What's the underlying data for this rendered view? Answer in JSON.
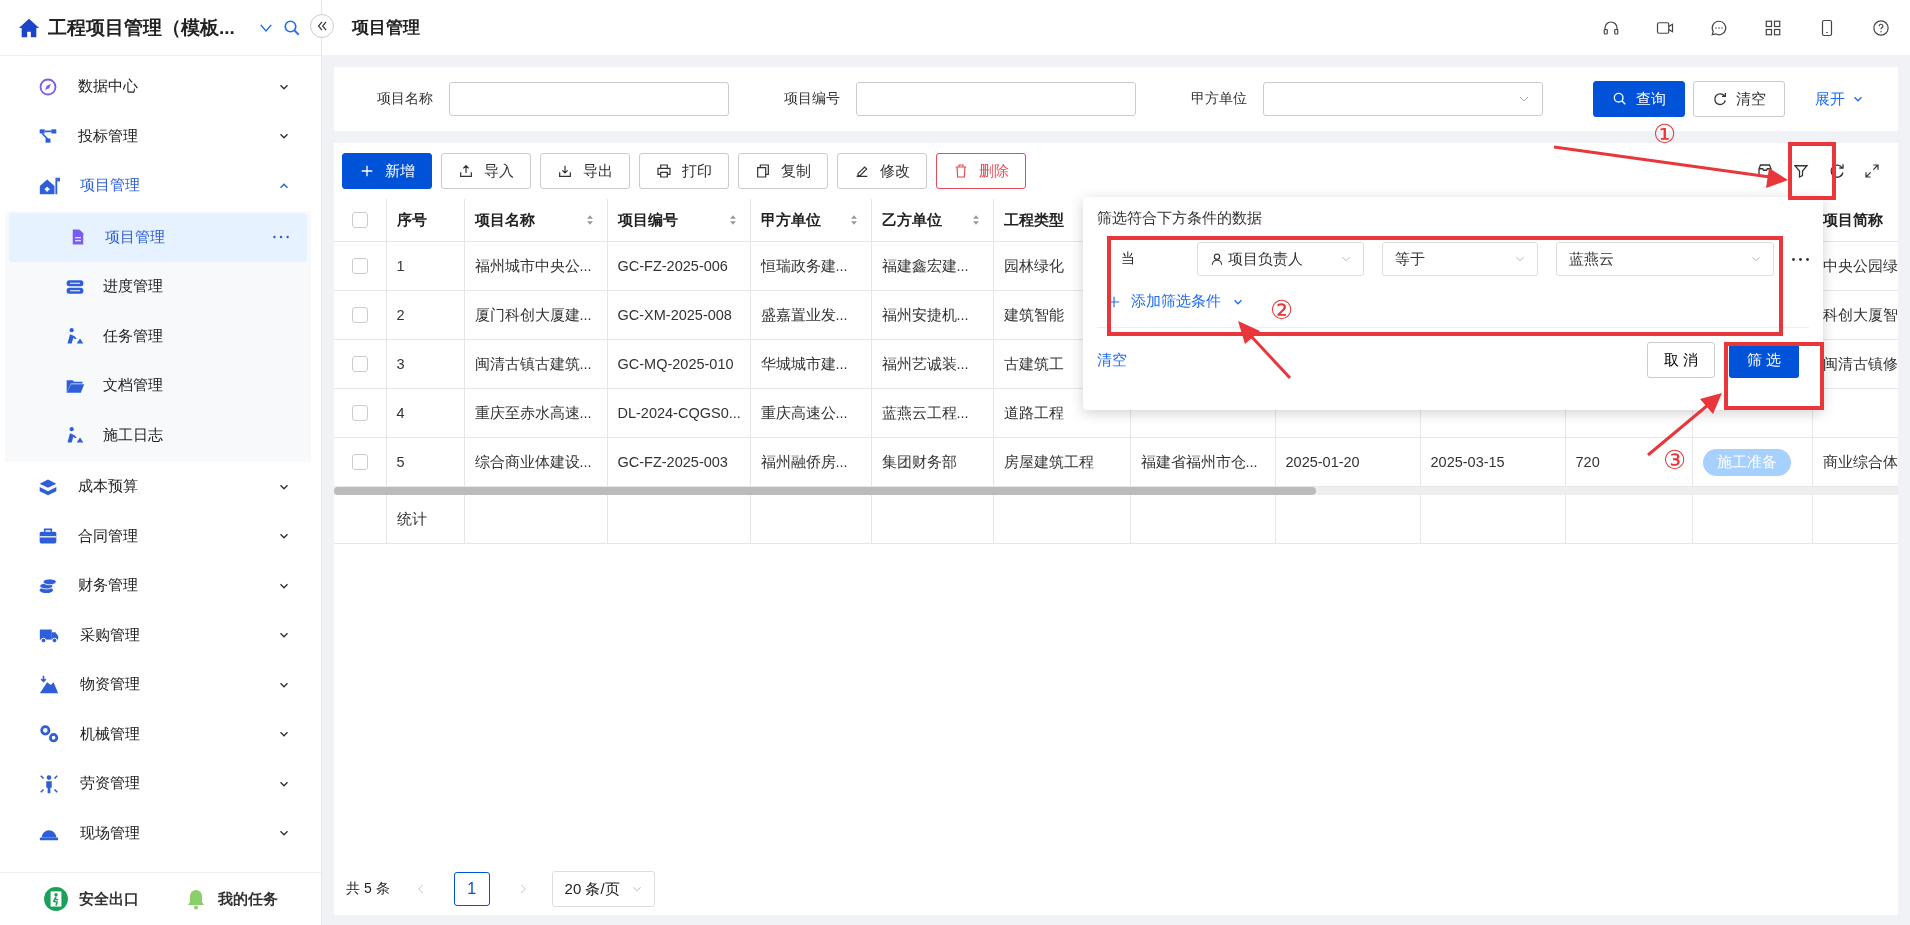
{
  "app": {
    "title": "工程项目管理（模板...",
    "page_title": "项目管理"
  },
  "sidebar": {
    "items": [
      {
        "label": "数据中心",
        "expanded": false
      },
      {
        "label": "投标管理",
        "expanded": false
      },
      {
        "label": "项目管理",
        "expanded": true,
        "children": [
          {
            "label": "项目管理",
            "selected": true
          },
          {
            "label": "进度管理",
            "selected": false
          },
          {
            "label": "任务管理",
            "selected": false
          },
          {
            "label": "文档管理",
            "selected": false
          },
          {
            "label": "施工日志",
            "selected": false
          }
        ]
      },
      {
        "label": "成本预算",
        "expanded": false
      },
      {
        "label": "合同管理",
        "expanded": false
      },
      {
        "label": "财务管理",
        "expanded": false
      },
      {
        "label": "采购管理",
        "expanded": false
      },
      {
        "label": "物资管理",
        "expanded": false
      },
      {
        "label": "机械管理",
        "expanded": false
      },
      {
        "label": "劳资管理",
        "expanded": false
      },
      {
        "label": "现场管理",
        "expanded": false
      }
    ],
    "footer": [
      {
        "label": "安全出口"
      },
      {
        "label": "我的任务"
      }
    ]
  },
  "search_form": {
    "fields": [
      {
        "label": "项目名称",
        "kind": "text"
      },
      {
        "label": "项目编号",
        "kind": "text"
      },
      {
        "label": "甲方单位",
        "kind": "select"
      }
    ],
    "query": "查询",
    "reset": "清空",
    "expand": "展开"
  },
  "toolbar": [
    {
      "label": "新增",
      "kind": "primary"
    },
    {
      "label": "导入",
      "kind": "default"
    },
    {
      "label": "导出",
      "kind": "default"
    },
    {
      "label": "打印",
      "kind": "default"
    },
    {
      "label": "复制",
      "kind": "default"
    },
    {
      "label": "修改",
      "kind": "default"
    },
    {
      "label": "删除",
      "kind": "danger"
    }
  ],
  "table": {
    "header_checked": false,
    "columns": [
      {
        "label": "序号",
        "sortable": false,
        "kind": "text"
      },
      {
        "label": "项目名称",
        "sortable": true,
        "kind": "text"
      },
      {
        "label": "项目编号",
        "sortable": true,
        "kind": "text"
      },
      {
        "label": "甲方单位",
        "sortable": true,
        "kind": "text"
      },
      {
        "label": "乙方单位",
        "sortable": true,
        "kind": "text"
      },
      {
        "label": "工程类型",
        "kind": "text"
      },
      {
        "kind": "text"
      },
      {
        "kind": "text"
      },
      {
        "kind": "text"
      },
      {
        "kind": "text"
      },
      {
        "kind": "status"
      },
      {
        "label": "项目简称",
        "kind": "text"
      }
    ],
    "rows": [
      {
        "checked": false,
        "cells": [
          "1",
          "福州城市中央公...",
          "GC-FZ-2025-006",
          "恒瑞政务建...",
          "福建鑫宏建...",
          "园林绿化",
          null,
          null,
          null,
          null,
          null,
          "中央公园绿"
        ]
      },
      {
        "checked": false,
        "cells": [
          "2",
          "厦门科创大厦建...",
          "GC-XM-2025-008",
          "盛嘉置业发...",
          "福州安捷机...",
          "建筑智能",
          null,
          null,
          null,
          null,
          null,
          "科创大厦智"
        ]
      },
      {
        "checked": false,
        "cells": [
          "3",
          "闽清古镇古建筑...",
          "GC-MQ-2025-010",
          "华城城市建...",
          "福州艺诚装...",
          "古建筑工",
          null,
          null,
          null,
          null,
          null,
          "闽清古镇修"
        ]
      },
      {
        "checked": false,
        "cells": [
          "4",
          "重庆至赤水高速...",
          "DL-2024-CQGS0...",
          "重庆高速公...",
          "蓝燕云工程...",
          "道路工程",
          null,
          null,
          null,
          null,
          null,
          null
        ]
      },
      {
        "checked": false,
        "cells": [
          "5",
          "综合商业体建设...",
          "GC-FZ-2025-003",
          "福州融侨房...",
          "集团财务部",
          "房屋建筑工程",
          "福建省福州市仓...",
          "2025-01-20",
          "2025-03-15",
          "720",
          "施工准备",
          "商业综合体"
        ]
      }
    ],
    "summary_label": "统计"
  },
  "pagination": {
    "total": "共 5 条",
    "pages": [
      {
        "label": "1",
        "selected": true
      }
    ],
    "page_size": "20 条/页"
  },
  "filter_popup": {
    "title": "筛选符合下方条件的数据",
    "prefix": "当",
    "field": "项目负责人",
    "operator": "等于",
    "value": "蓝燕云",
    "add": "添加筛选条件",
    "clear": "清空",
    "cancel": "取 消",
    "confirm": "筛 选"
  },
  "annotations": [
    {
      "label": "①"
    },
    {
      "label": "②"
    },
    {
      "label": "③"
    }
  ]
}
